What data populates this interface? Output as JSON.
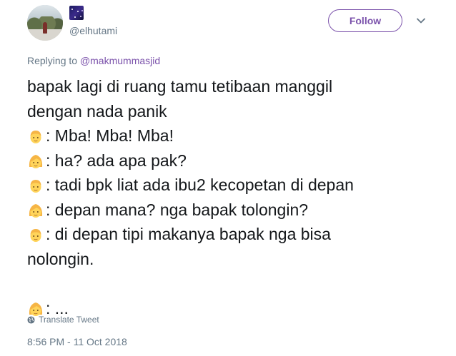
{
  "header": {
    "handle": "@elhutami",
    "follow_label": "Follow",
    "accent_color": "#7b52ab"
  },
  "reply": {
    "prefix": "Replying to",
    "mention": "@makmummasjid"
  },
  "tweet": {
    "lines": [
      {
        "emoji": "",
        "text": "bapak lagi di ruang tamu tetibaan manggil"
      },
      {
        "emoji": "",
        "text": "dengan nada panik"
      },
      {
        "emoji": "man-face",
        "text": ": Mba! Mba! Mba!"
      },
      {
        "emoji": "woman-face",
        "text": ": ha? ada apa pak?"
      },
      {
        "emoji": "man-face",
        "text": ": tadi bpk liat ada ibu2 kecopetan di depan"
      },
      {
        "emoji": "woman-face",
        "text": ": depan mana? nga bapak tolongin?"
      },
      {
        "emoji": "man-face",
        "text": ": di depan tipi makanya bapak nga bisa"
      },
      {
        "emoji": "",
        "text": "nolongin."
      },
      {
        "emoji": "",
        "text": ""
      },
      {
        "emoji": "woman-face",
        "text": ": ..."
      }
    ]
  },
  "footer": {
    "translate_label": "Translate Tweet",
    "timestamp": "8:56 PM - 11 Oct 2018"
  },
  "icons": {
    "avatar": "profile-photo",
    "badge": "galaxy-emoji",
    "caret": "chevron-down-icon",
    "globe": "globe-icon"
  }
}
